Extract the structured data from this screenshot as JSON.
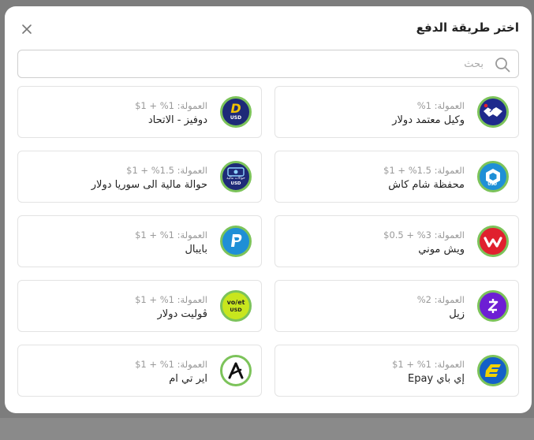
{
  "modal": {
    "title": "اختر طريقة الدفع",
    "search_placeholder": "بحث"
  },
  "methods": [
    {
      "name": "وكيل معتمد دولار",
      "fee": "العمولة: 1%",
      "icon": "handshake-icon",
      "color": "#1f2a8c"
    },
    {
      "name": "دوفيز - الاتحاد",
      "fee": "العمولة: 1% + 1$",
      "icon": "dofiz-usd-icon",
      "color": "#1e2a78"
    },
    {
      "name": "محفظة شام كاش",
      "fee": "العمولة: 1.5% + 1$",
      "icon": "sham-cash-icon",
      "color": "#1f8fd6"
    },
    {
      "name": "حوالة مالية الى سوريا دولار",
      "fee": "العمولة: 1.5% + 1$",
      "icon": "money-transfer-usd-icon",
      "color": "#1e2a78"
    },
    {
      "name": "ويش موني",
      "fee": "العمولة: 3% + 0.5$",
      "icon": "wish-money-icon",
      "color": "#e0202e"
    },
    {
      "name": "بايبال",
      "fee": "العمولة: 1% + 1$",
      "icon": "paypal-icon",
      "color": "#1f8fd6"
    },
    {
      "name": "زيل",
      "fee": "العمولة: 2%",
      "icon": "zelle-icon",
      "color": "#6d1ed4"
    },
    {
      "name": "ڤوليت دولار",
      "fee": "العمولة: 1% + 1$",
      "icon": "volet-usd-icon",
      "color": "#c8e61e"
    },
    {
      "name": "إي باي Epay",
      "fee": "العمولة: 1% + 1$",
      "icon": "epay-icon",
      "color": "#1460c8"
    },
    {
      "name": "اير تي ام",
      "fee": "العمولة: 1% + 1$",
      "icon": "airtm-icon",
      "color": "#ffffff"
    }
  ],
  "logo_texts": {
    "usd": "USD",
    "dofiz": "D",
    "volet_top": "vo/et",
    "transfer_ar": "حوالات مالية"
  }
}
